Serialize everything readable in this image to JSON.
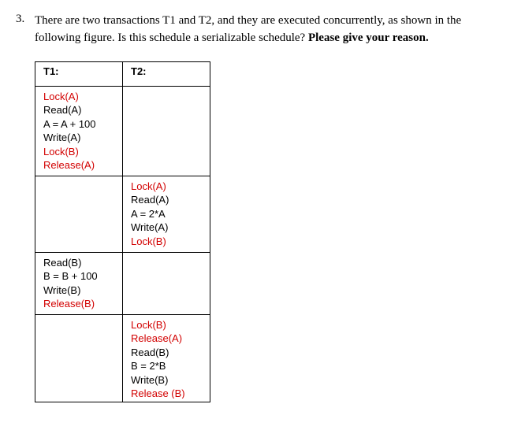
{
  "question": {
    "number": "3.",
    "text_part1": "There are two transactions T1 and T2, and they are executed concurrently, as shown in the following figure. Is this schedule a serializable schedule? ",
    "text_bold": "Please give your reason."
  },
  "table": {
    "headers": {
      "t1": "T1:",
      "t2": "T2:"
    },
    "rows": [
      {
        "t1": [
          {
            "text": "Lock(A)",
            "red": true
          },
          {
            "text": "Read(A)",
            "red": false
          },
          {
            "text": "A = A + 100",
            "red": false
          },
          {
            "text": "Write(A)",
            "red": false
          },
          {
            "text": "Lock(B)",
            "red": true
          },
          {
            "text": "Release(A)",
            "red": true
          }
        ],
        "t2": []
      },
      {
        "t1": [],
        "t2": [
          {
            "text": "Lock(A)",
            "red": true
          },
          {
            "text": "Read(A)",
            "red": false
          },
          {
            "text": "A = 2*A",
            "red": false
          },
          {
            "text": "Write(A)",
            "red": false
          },
          {
            "text": "Lock(B)",
            "red": true
          }
        ]
      },
      {
        "t1": [
          {
            "text": "Read(B)",
            "red": false
          },
          {
            "text": "B = B + 100",
            "red": false
          },
          {
            "text": "Write(B)",
            "red": false
          },
          {
            "text": "Release(B)",
            "red": true
          }
        ],
        "t2": []
      },
      {
        "t1": [],
        "t2": [
          {
            "text": "Lock(B)",
            "red": true
          },
          {
            "text": "Release(A)",
            "red": true
          },
          {
            "text": "Read(B)",
            "red": false
          },
          {
            "text": "B = 2*B",
            "red": false
          },
          {
            "text": "Write(B)",
            "red": false
          },
          {
            "text": "Release (B)",
            "red": true
          }
        ]
      }
    ]
  }
}
